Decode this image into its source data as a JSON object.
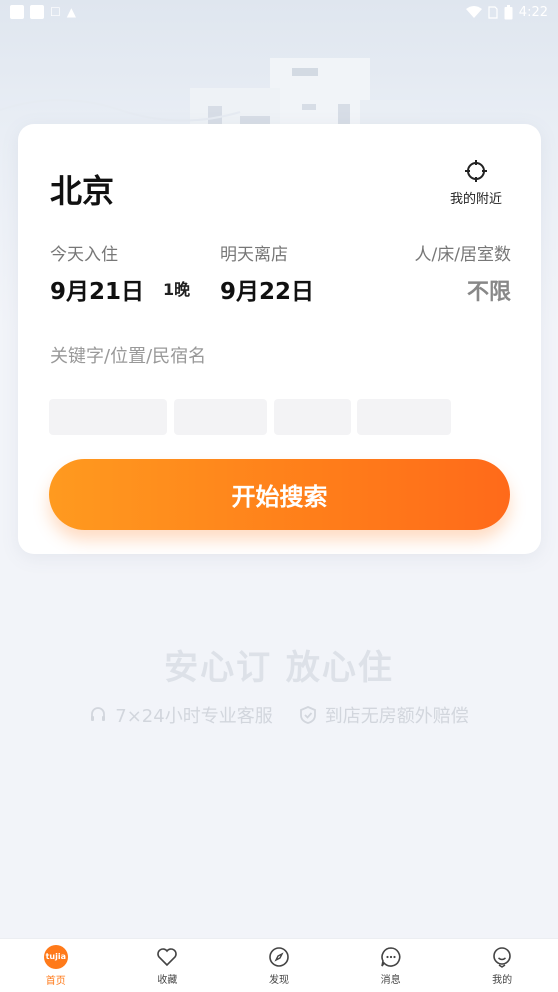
{
  "status_bar": {
    "time": "4:22"
  },
  "search_card": {
    "city": "北京",
    "nearby_label": "我的附近",
    "checkin": {
      "label": "今天入住",
      "date": "9月21日"
    },
    "nights": "1晚",
    "checkout": {
      "label": "明天离店",
      "date": "9月22日"
    },
    "guests": {
      "label": "人/床/居室数",
      "value": "不限"
    },
    "keyword_placeholder": "关键字/位置/民宿名",
    "search_button": "开始搜索"
  },
  "promo": {
    "slogan": "安心订 放心住",
    "guarantee_1": "7×24小时专业客服",
    "guarantee_2": "到店无房额外赔偿"
  },
  "tabbar": {
    "home": "首页",
    "home_logo": "tujia",
    "favorites": "收藏",
    "discover": "发现",
    "messages": "消息",
    "mine": "我的"
  },
  "colors": {
    "accent": "#ff7a1a"
  }
}
